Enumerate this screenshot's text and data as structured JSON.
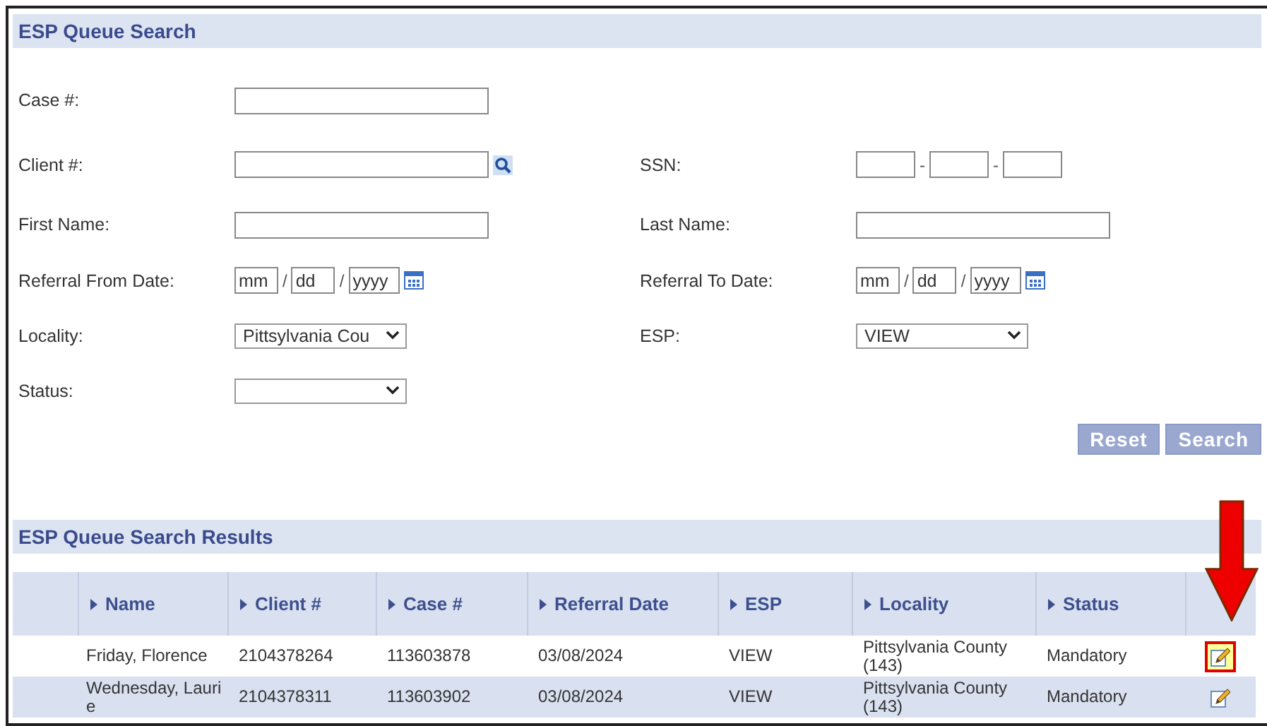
{
  "search_panel": {
    "title": "ESP Queue Search",
    "rows": [
      [
        {
          "label": "Case #:",
          "kind": "text"
        }
      ],
      [
        {
          "label": "Client #:",
          "kind": "lookup"
        },
        {
          "label": "SSN:",
          "kind": "ssn",
          "separators": [
            "-",
            "-"
          ]
        }
      ],
      [
        {
          "label": "First Name:",
          "kind": "text"
        },
        {
          "label": "Last Name:",
          "kind": "text"
        }
      ],
      [
        {
          "label": "Referral From Date:",
          "kind": "date",
          "parts": [
            "mm",
            "dd",
            "yyyy"
          ],
          "separators": [
            "/",
            "/"
          ]
        },
        {
          "label": "Referral To Date:",
          "kind": "date",
          "parts": [
            "mm",
            "dd",
            "yyyy"
          ],
          "separators": [
            "/",
            "/"
          ]
        }
      ],
      [
        {
          "label": "Locality:",
          "kind": "select",
          "value": "Pittsylvania Cou"
        },
        {
          "label": "ESP:",
          "kind": "select",
          "value": "VIEW"
        }
      ],
      [
        {
          "label": "Status:",
          "kind": "select"
        }
      ]
    ],
    "buttons": [
      "Reset",
      "Search"
    ]
  },
  "results": {
    "title": "ESP Queue Search Results",
    "columns": [
      "Name",
      "Client #",
      "Case #",
      "Referral Date",
      "ESP",
      "Locality",
      "Status"
    ],
    "rows": [
      {
        "cells": [
          "Friday, Florence",
          "2104378264",
          "113603878",
          "03/08/2024",
          "VIEW",
          "Pittsylvania County (143)",
          "Mandatory"
        ],
        "highlighted": true
      },
      {
        "cells": [
          "Wednesday, Laurie",
          "2104378311",
          "113603902",
          "03/08/2024",
          "VIEW",
          "Pittsylvania County (143)",
          "Mandatory"
        ],
        "highlighted": false
      }
    ]
  },
  "annotation": {
    "arrow": true
  }
}
